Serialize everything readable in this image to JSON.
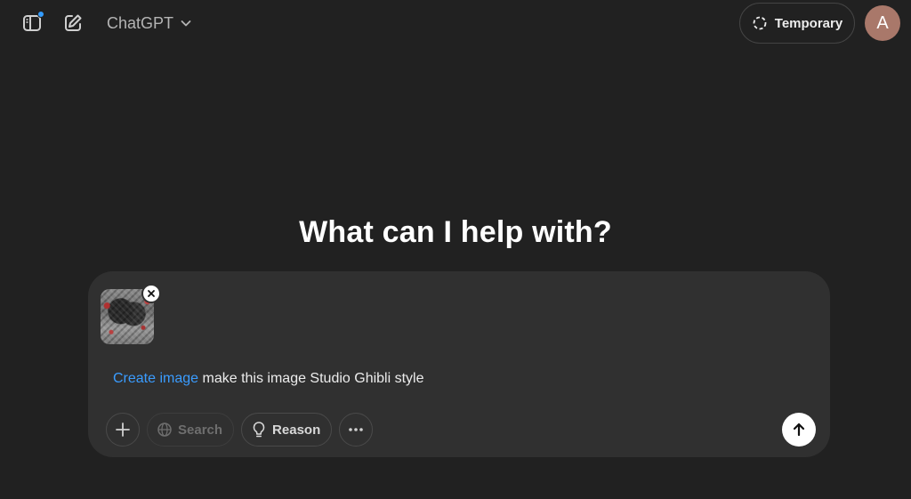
{
  "header": {
    "model_name": "ChatGPT",
    "temporary_label": "Temporary",
    "avatar_initial": "A"
  },
  "main": {
    "headline": "What can I help with?"
  },
  "composer": {
    "tool_tag": "Create image",
    "prompt_text": " make this image Studio Ghibli style",
    "search_label": "Search",
    "reason_label": "Reason"
  },
  "colors": {
    "background": "#212121",
    "composer": "#303030",
    "accent_blue": "#3a9cff",
    "avatar": "#a9786a"
  },
  "icons": {
    "sidebar": "sidebar-toggle-icon",
    "new_chat": "new-chat-icon",
    "model_dropdown": "chevron-down-icon",
    "temporary": "dashed-circle-icon",
    "remove": "close-icon",
    "add": "plus-icon",
    "search": "globe-icon",
    "reason": "lightbulb-icon",
    "more": "ellipsis-icon",
    "send": "arrow-up-icon"
  }
}
